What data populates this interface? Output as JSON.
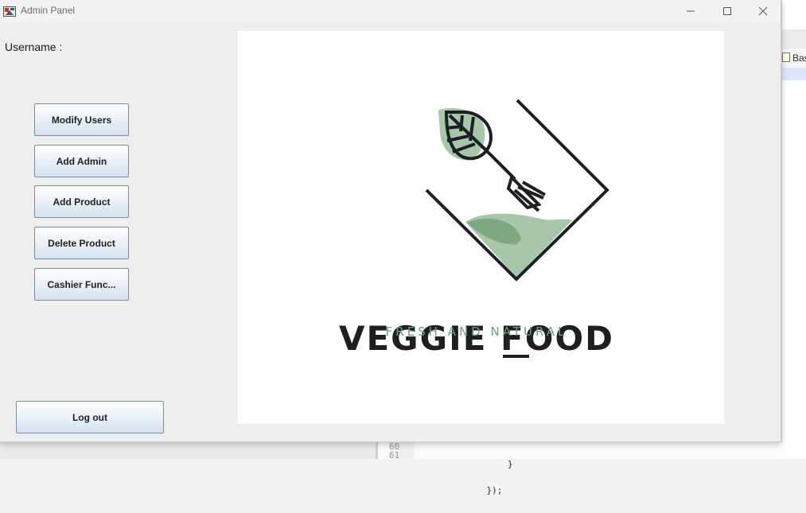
{
  "window": {
    "title": "Admin Panel",
    "controls": [
      "minimize",
      "maximize",
      "close"
    ]
  },
  "form": {
    "username_label": "Username :"
  },
  "sidebar": {
    "buttons": [
      {
        "label": "Modify Users"
      },
      {
        "label": "Add Admin"
      },
      {
        "label": "Add Product"
      },
      {
        "label": "Delete Product"
      },
      {
        "label": "Cashier Func..."
      }
    ],
    "logout_label": "Log out"
  },
  "logo": {
    "name": "VEGGIE FOOD",
    "tagline": "FRESH AND NATURAL",
    "colors": {
      "dark": "#1d1f22",
      "green_light": "#a8c6a8",
      "green_mid": "#7fa882",
      "green_text": "#6f9f79"
    }
  },
  "background": {
    "tab_label": "Bas",
    "gutter_lines": [
      "60",
      "61"
    ],
    "code_lines": [
      "        }",
      "    });"
    ]
  }
}
